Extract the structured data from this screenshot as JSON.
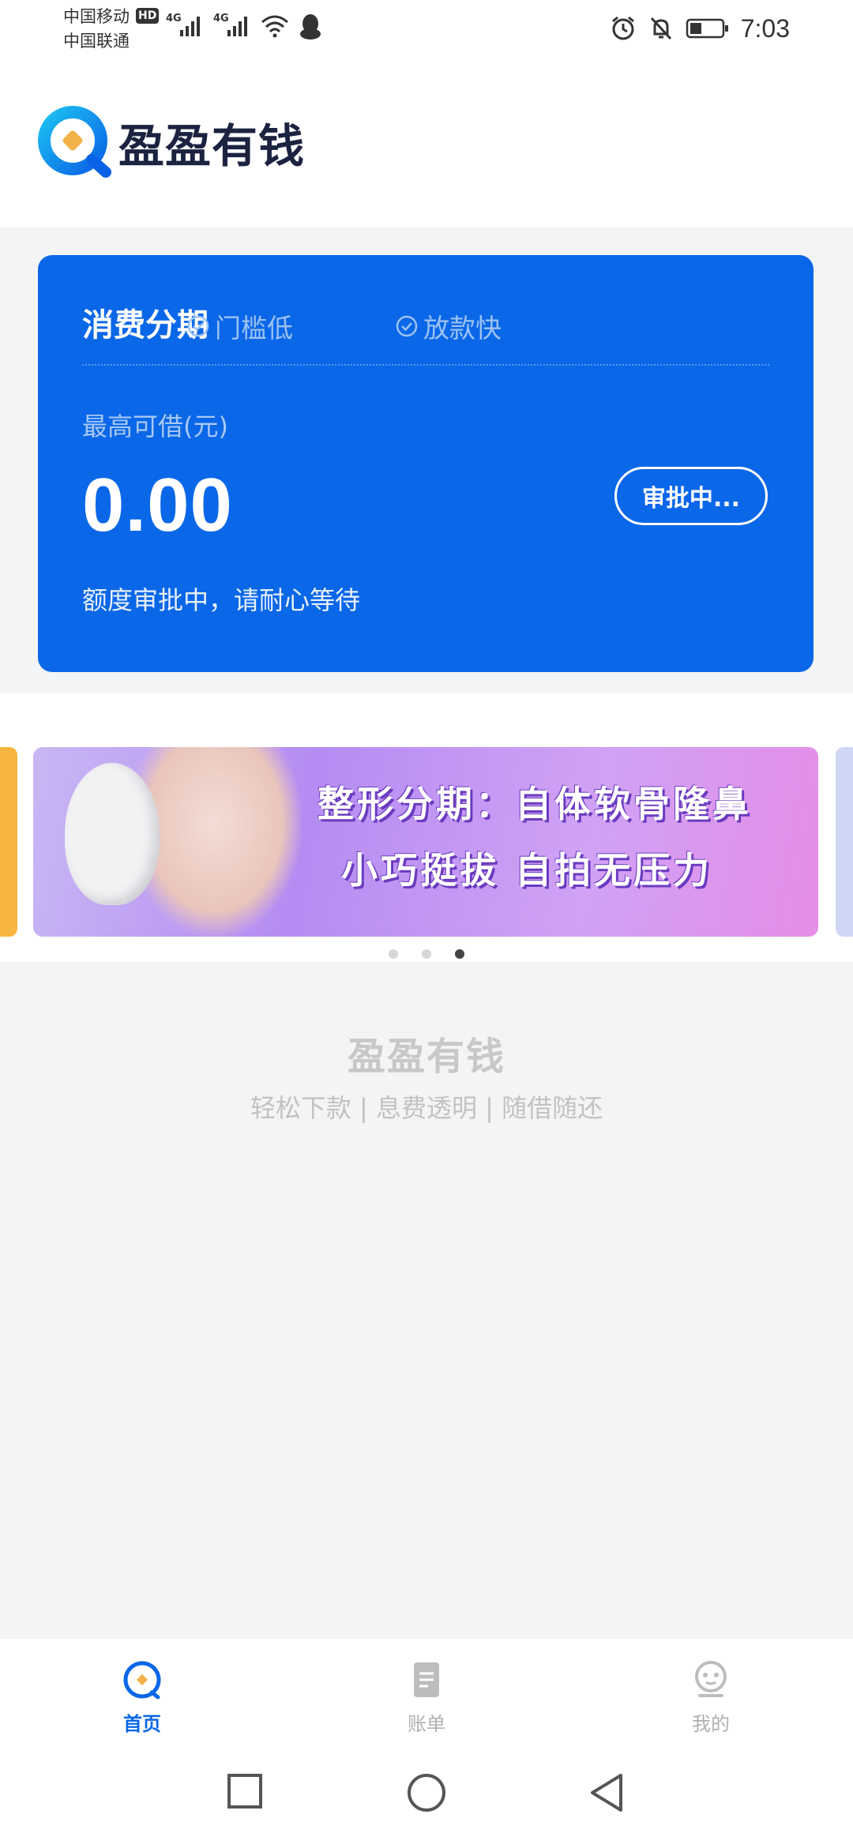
{
  "status_bar": {
    "carrier1": "中国移动",
    "carrier2": "中国联通",
    "hd": "HD",
    "net1": "4G",
    "net2": "4G",
    "time": "7:03"
  },
  "header": {
    "app_name": "盈盈有钱"
  },
  "card": {
    "title": "消费分期",
    "tags": [
      "门槛低",
      "放款快"
    ],
    "max_label": "最高可借(元)",
    "amount": "0.00",
    "status_button": "审批中...",
    "note": "额度审批中，请耐心等待"
  },
  "banner": {
    "line1": "整形分期：自体软骨隆鼻",
    "line2": "小巧挺拔 自拍无压力",
    "slides": 3,
    "active_slide": 3
  },
  "footer_brand": {
    "name": "盈盈有钱",
    "slogan": "轻松下款 | 息费透明 | 随借随还"
  },
  "tabs": {
    "home": "首页",
    "bills": "账单",
    "mine": "我的"
  },
  "colors": {
    "primary": "#0a67e8",
    "tab_inactive": "#b0b0b0",
    "background_gray": "#f3f4f6"
  }
}
